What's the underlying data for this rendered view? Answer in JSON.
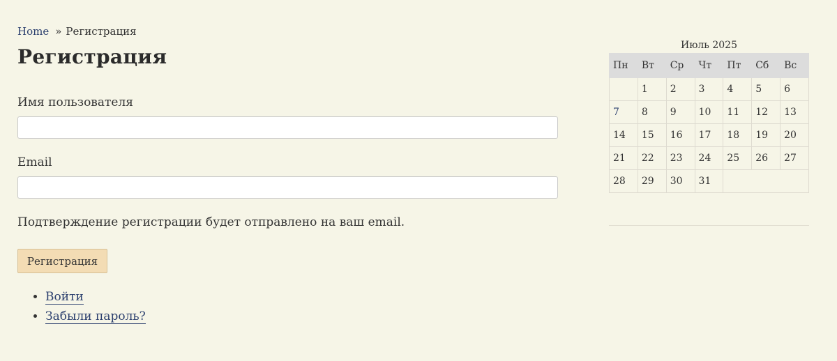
{
  "breadcrumb": {
    "home": "Home",
    "separator": "»",
    "current": "Регистрация"
  },
  "page": {
    "title": "Регистрация"
  },
  "form": {
    "username_label": "Имя пользователя",
    "username_value": "",
    "email_label": "Email",
    "email_value": "",
    "note": "Подтверждение регистрации будет отправлено на ваш email.",
    "submit_label": "Регистрация"
  },
  "links": [
    {
      "label": "Войти"
    },
    {
      "label": "Забыли пароль?"
    }
  ],
  "calendar": {
    "caption": "Июль 2025",
    "weekdays": [
      "Пн",
      "Вт",
      "Ср",
      "Чт",
      "Пт",
      "Сб",
      "Вс"
    ],
    "weeks": [
      [
        "",
        "1",
        "2",
        "3",
        "4",
        "5",
        "6"
      ],
      [
        "7",
        "8",
        "9",
        "10",
        "11",
        "12",
        "13"
      ],
      [
        "14",
        "15",
        "16",
        "17",
        "18",
        "19",
        "20"
      ],
      [
        "21",
        "22",
        "23",
        "24",
        "25",
        "26",
        "27"
      ],
      [
        "28",
        "29",
        "30",
        "31",
        "",
        "",
        ""
      ]
    ],
    "linked_day": "7"
  },
  "colors": {
    "background": "#f6f5e7",
    "link": "#2b3f6e",
    "button": "#f3dcb4",
    "calendar_header": "#dcdcdc"
  }
}
